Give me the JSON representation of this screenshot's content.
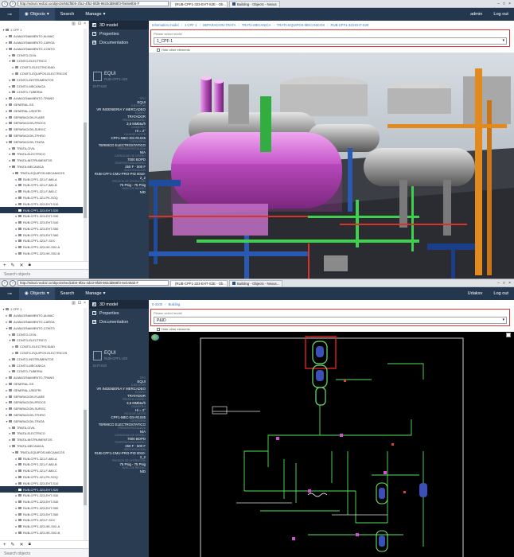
{
  "browser": {
    "url_a": "http://edsol.neobiz.io/objects/662f5b9-2fa2-4f52-8fd8-9820dd868f3-f6e8e8b5-F",
    "url_b": "http://edsol.neobiz.io/objects/6ed15b0-8f2a-4d23-8fd8-982dd868f3-6eb40ab-F",
    "tab1": "(RUB-CPF1-323-EHT-S2E - Ob...",
    "tab2": "Building - Objects - Nexus",
    "tab2b": "Building - Objects - Nexus..."
  },
  "appbar": {
    "objects": "Objects",
    "search": "Search",
    "manage": "Manage",
    "user_a": "admin",
    "user_b": "Udaksv",
    "logout": "Log out"
  },
  "tree": {
    "rows": [
      "1 CPF 1",
      "ALMACENAMIENTO-ALMAC",
      "ALMACENAMIENTO-CARGA",
      "ALMACENAMIENTO-CONTG",
      "CONTG-CIVIL",
      "CONTG-ELECTRICO",
      "CONTG-ELECTRICIDAD",
      "CONTG-EQUIPOS-ELECTRICOS",
      "CONTG-INSTRUMENTOS",
      "CONTG-MECANICA",
      "CONTG-TUBERIA",
      "ALMACENAMIENTO-TRANS",
      "GENERAL-SS",
      "GENERAL-USGFRI",
      "SEPARACION-FLARE",
      "SEPARACION-PROCS",
      "SEPARACION-SURGC",
      "SEPARACION-TFHRO",
      "SEPARACION-TRATA",
      "TRATA-CIVIL",
      "TRATA-ELECTRICO",
      "TRATA-INSTRUMENTOS",
      "TRATA-MECANICA",
      "TRATA-EQUIPOS-MECANICOS",
      "RUB-CPF1-321-F-880-A",
      "RUB-CPF1-321-F-880-B",
      "RUB-CPF1-321-F-880-C",
      "RUB-CPF1-321-PK-SOQ",
      "RUB-CPF1-323-EHT-S10",
      "RUB-CPF1-323-EHT-S20",
      "RUB-CPF1-323-EHT-S30",
      "RUB-CPF1-323-EHT-S40",
      "RUB-CPF1-323-EHT-S50",
      "RUB-CPF1-323-EHT-S60",
      "RUB-CPF1-323-F-SXX",
      "RUB-CPF1-323-HE-S02-A",
      "RUB-CPF1-323-HE-S02-B"
    ],
    "search_placeholder": "Search objects"
  },
  "side": {
    "tab_model": "3D model",
    "tab_props": "Properties",
    "tab_docs": "Documentation",
    "equi_title": "EQUI",
    "equi_sub": "RUB-CPF1-323",
    "equi_unit": "EHT-S20",
    "props": [
      {
        "label": "TIPO",
        "value": "EQUI"
      },
      {
        "label": "EJECUTOR",
        "value": "VR INGENIERIA Y MERCADEO"
      },
      {
        "label": "EQUIPO",
        "value": "TRATADOR"
      },
      {
        "label": "PRESION DISEÑO",
        "value": "3,5 MMbtu/h"
      },
      {
        "label": "DIAMETRO",
        "value": "Hi = 2°"
      },
      {
        "label": "HOJA DE DATOS",
        "value": "CPF1-MEC-DS-R1045"
      },
      {
        "label": "CATEGORIA",
        "value": "TERMICO ELECTROSTATICO"
      },
      {
        "label": "PRESION ROTULADA",
        "value": "N/A"
      },
      {
        "label": "CAPACIDAD DE DISEÑO",
        "value": "7000 BOPD"
      },
      {
        "label": "TEMPERATURA DISEÑO",
        "value": "250 F - 500 F"
      },
      {
        "label": "IDENTIFICACION",
        "value": "RUB-CPF1-CMU-PRO-PID 0010-2_2"
      },
      {
        "label": "PRESION DE OPERACION",
        "value": "75 Psig - 75 Psig"
      },
      {
        "label": "NIVEL DE RIESGO",
        "value": "N/D"
      }
    ]
  },
  "main": {
    "crumbs_a": [
      "Information model",
      "1 CPF 1",
      "SEPARACION-TRATA",
      "TRATA-MECANICA",
      "TRATA-EQUIPOS-MECANICOS",
      "RUB-CPF1-323-EHT-S20"
    ],
    "crumbs_b": [
      "0-3100",
      "Building"
    ],
    "model_placeholder": "Please select model",
    "model_a": "1_CPF-1",
    "model_b": "P&ID",
    "hide_other": "Hide other elements"
  }
}
